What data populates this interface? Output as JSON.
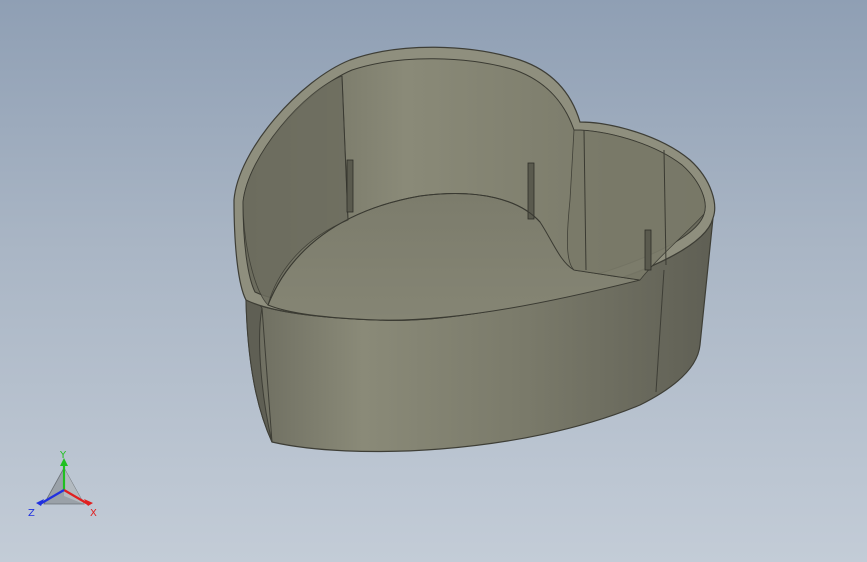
{
  "viewport": {
    "model_name": "heart-box",
    "background_top": "#8f9fb4",
    "background_bottom": "#c3ccd7"
  },
  "triad": {
    "x_label": "X",
    "y_label": "Y",
    "z_label": "Z",
    "x_color": "#e02020",
    "y_color": "#20c020",
    "z_color": "#2030e0"
  }
}
